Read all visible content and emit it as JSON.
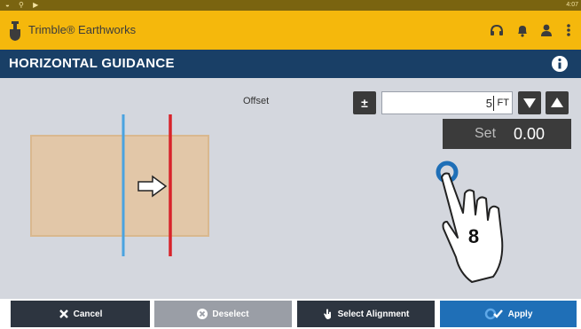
{
  "status": {
    "time": "4:07"
  },
  "app": {
    "title": "Trimble® Earthworks"
  },
  "page": {
    "title": "HORIZONTAL GUIDANCE"
  },
  "offset": {
    "label": "Offset",
    "plusminus": "±",
    "value": "5",
    "unit": "FT"
  },
  "set": {
    "label": "Set",
    "value": "0.00"
  },
  "step_number": "8",
  "footer": {
    "cancel": "Cancel",
    "deselect": "Deselect",
    "select_alignment": "Select Alignment",
    "apply": "Apply"
  },
  "icons": {
    "app_logo": "shovel-icon",
    "headset": "headset-icon",
    "bell": "bell-icon",
    "user": "user-icon",
    "menu": "more-vert-icon",
    "info": "info-icon"
  },
  "colors": {
    "appbar": "#f5b80c",
    "titlebar": "#193f66",
    "alignment_blue": "#4aa3e0",
    "offset_red": "#d8232a",
    "apply": "#1f6fb7"
  }
}
